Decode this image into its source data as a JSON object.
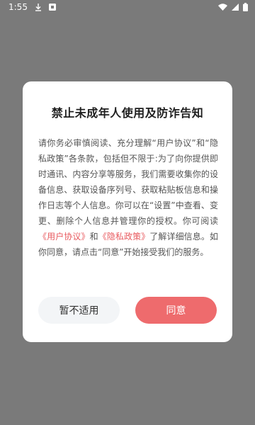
{
  "status_bar": {
    "time": "1:55"
  },
  "dialog": {
    "title": "禁止未成年人使用及防诈告知",
    "body_part1": "请你务必审慎阅读、充分理解“用户协议”和“隐私政策”各条款，包括但不限于:为了向你提供即时通讯、内容分享等服务，我们需要收集你的设备信息、获取设备序列号、获取粘贴板信息和操作日志等个人信息。你可以在“设置”中查看、变更、删除个人信息并管理你的授权。你可阅读",
    "link_user_agreement": "《用户协议》",
    "body_and": "和",
    "link_privacy_policy": "《隐私政策》",
    "body_part2": "了解详细信息。如你同意，请点击“同意”开始接受我们的服务。",
    "decline_label": "暂不适用",
    "agree_label": "同意",
    "link_color": "#e85a5f",
    "agree_color": "#ee6b6d"
  }
}
